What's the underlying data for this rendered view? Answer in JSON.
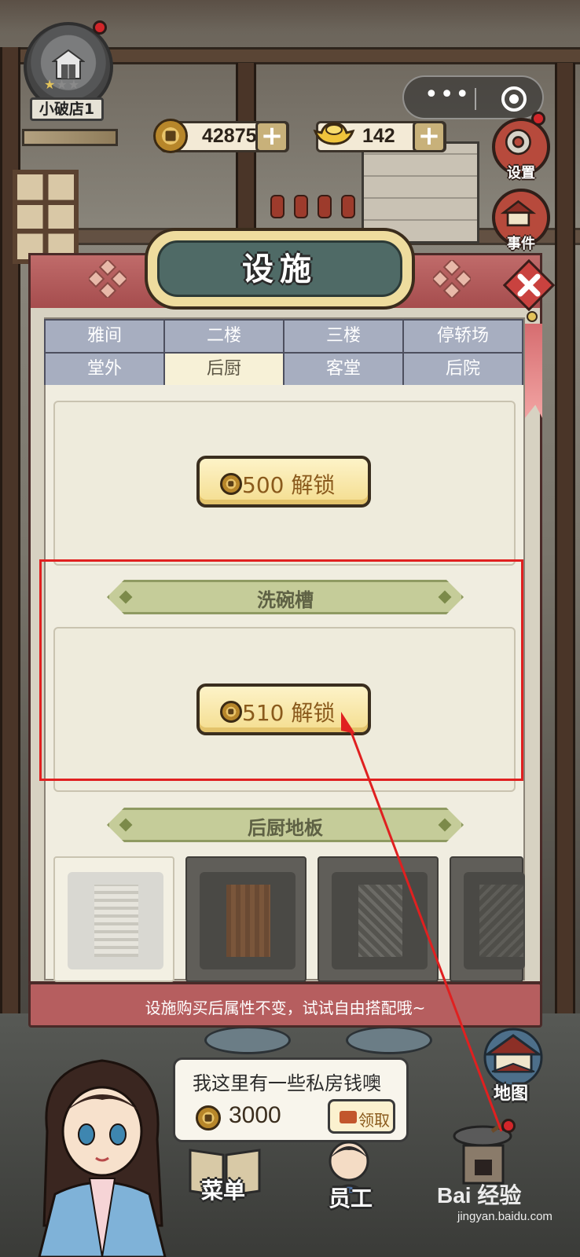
{
  "hud": {
    "shop_name": "小破店1",
    "copper": "42875",
    "gold": "142",
    "plus": "+"
  },
  "side": {
    "settings": "设置",
    "events": "事件",
    "map": "地图"
  },
  "panel": {
    "title": "设施",
    "tabs": [
      "雅间",
      "二楼",
      "三楼",
      "停轿场",
      "堂外",
      "后厨",
      "客堂",
      "后院"
    ],
    "active_tab": "后厨",
    "unlock_1": "500 解锁",
    "section_1": "洗碗槽",
    "unlock_2": "510 解锁",
    "section_2": "后厨地板",
    "footer": "设施购买后属性不变，试试自由搭配哦~"
  },
  "bubble": {
    "text": "我这里有一些私房钱噢",
    "amount": "3000",
    "claim": "领取"
  },
  "nav": {
    "menu": "菜单",
    "staff": "员工"
  },
  "watermark": {
    "main": "Bai 经验",
    "sub": "jingyan.baidu.com"
  },
  "colors": {
    "panel_roof": "#b4595a",
    "title_plaque": "#4f6a66",
    "tab_inactive": "#a7aec0",
    "tab_active": "#f7f1d7",
    "banner": "#c5cc99",
    "highlight": "#e02020"
  }
}
